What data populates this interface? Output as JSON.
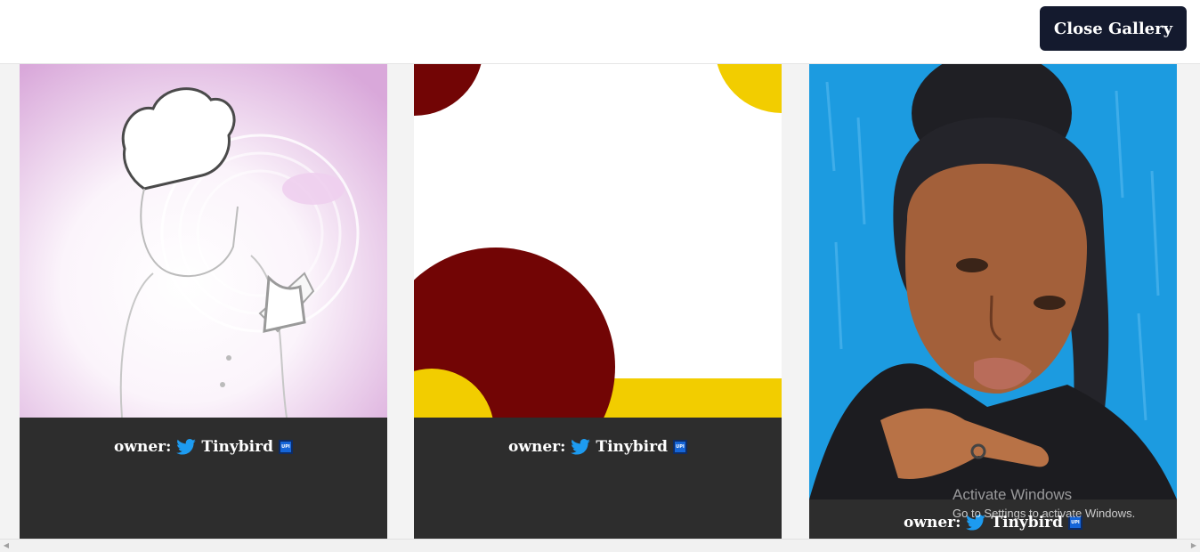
{
  "header": {
    "close_button_label": "Close Gallery"
  },
  "cards": [
    {
      "owner_prefix": "owner:",
      "owner_name": "Tinybird",
      "badge_text": "UPI",
      "image_desc": "chef-illustration"
    },
    {
      "owner_prefix": "owner:",
      "owner_name": "Tinybird",
      "badge_text": "UPI",
      "image_desc": "abstract-shapes"
    },
    {
      "owner_prefix": "owner:",
      "owner_name": "Tinybird",
      "badge_text": "UPI",
      "image_desc": "portrait-painting"
    }
  ],
  "icons": {
    "owner_icon": "twitter-bird-icon",
    "badge_icon": "upi-badge-icon"
  },
  "colors": {
    "header_button_bg": "#141a2e",
    "card_footer_bg": "#2d2d2d",
    "twitter_blue": "#1d9bf0",
    "maroon": "#720505",
    "yellow": "#f2cd00",
    "sky_blue": "#1c9be0"
  },
  "watermark": {
    "title": "Activate Windows",
    "subtitle": "Go to Settings to activate Windows."
  }
}
